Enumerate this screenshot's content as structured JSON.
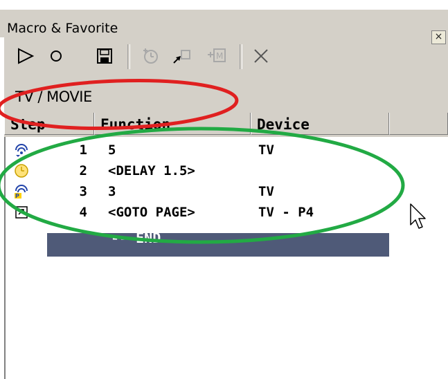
{
  "window": {
    "title": "Macro & Favorite",
    "close_symbol": "×"
  },
  "toolbar": {
    "buttons": [
      {
        "icon": "play-icon"
      },
      {
        "icon": "record-icon"
      },
      {
        "icon": "save-icon"
      },
      {
        "icon": "add-delay-icon"
      },
      {
        "icon": "add-jump-icon"
      },
      {
        "icon": "add-macro-icon"
      },
      {
        "icon": "delete-icon"
      }
    ]
  },
  "group": {
    "label": "TV / MOVIE"
  },
  "columns": {
    "step": "Step",
    "function": "Function",
    "device": "Device"
  },
  "rows": [
    {
      "icon": "ir-signal-icon",
      "step": "1",
      "function": "5",
      "device": "TV"
    },
    {
      "icon": "clock-icon",
      "step": "2",
      "function": "<DELAY 1.5>",
      "device": ""
    },
    {
      "icon": "ir-signal-p-icon",
      "step": "3",
      "function": "3",
      "device": "TV"
    },
    {
      "icon": "goto-page-icon",
      "step": "4",
      "function": "<GOTO PAGE>",
      "device": "TV - P4"
    }
  ],
  "end_row": {
    "label": "-- END"
  },
  "annotations": {
    "red": "#e02020",
    "green": "#22aa44"
  }
}
